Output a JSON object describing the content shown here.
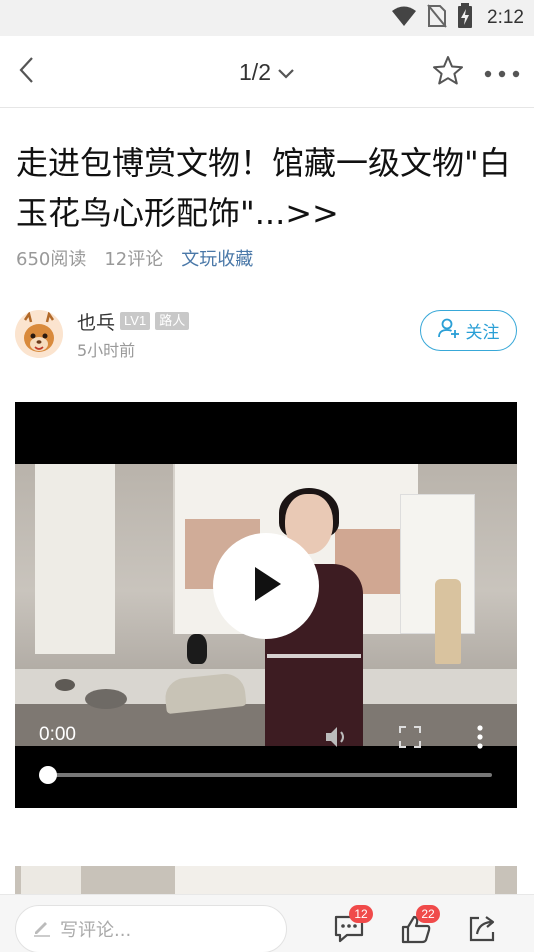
{
  "status_bar": {
    "time": "2:12",
    "icons": [
      "wifi-icon",
      "no-sim-icon",
      "battery-charging-icon"
    ]
  },
  "nav": {
    "pager": "1/2",
    "icons": [
      "back-arrow-icon",
      "chevron-down-icon",
      "star-icon",
      "more-icon"
    ]
  },
  "article": {
    "title": "走进包博赏文物！馆藏一级文物\"白玉花鸟心形配饰\"...>>",
    "reads": "650阅读",
    "comments": "12评论",
    "category": "文玩收藏"
  },
  "author": {
    "name": "也乓",
    "level": "LV1",
    "rank": "路人",
    "time": "5小时前",
    "follow_label": "关注"
  },
  "video": {
    "current_time": "0:00",
    "progress": 0
  },
  "bottom_bar": {
    "comment_placeholder": "写评论...",
    "comment_count": "12",
    "like_count": "22"
  },
  "colors": {
    "accent": "#2a9fd6",
    "category": "#4a78a8",
    "badge": "#f04a4a"
  }
}
